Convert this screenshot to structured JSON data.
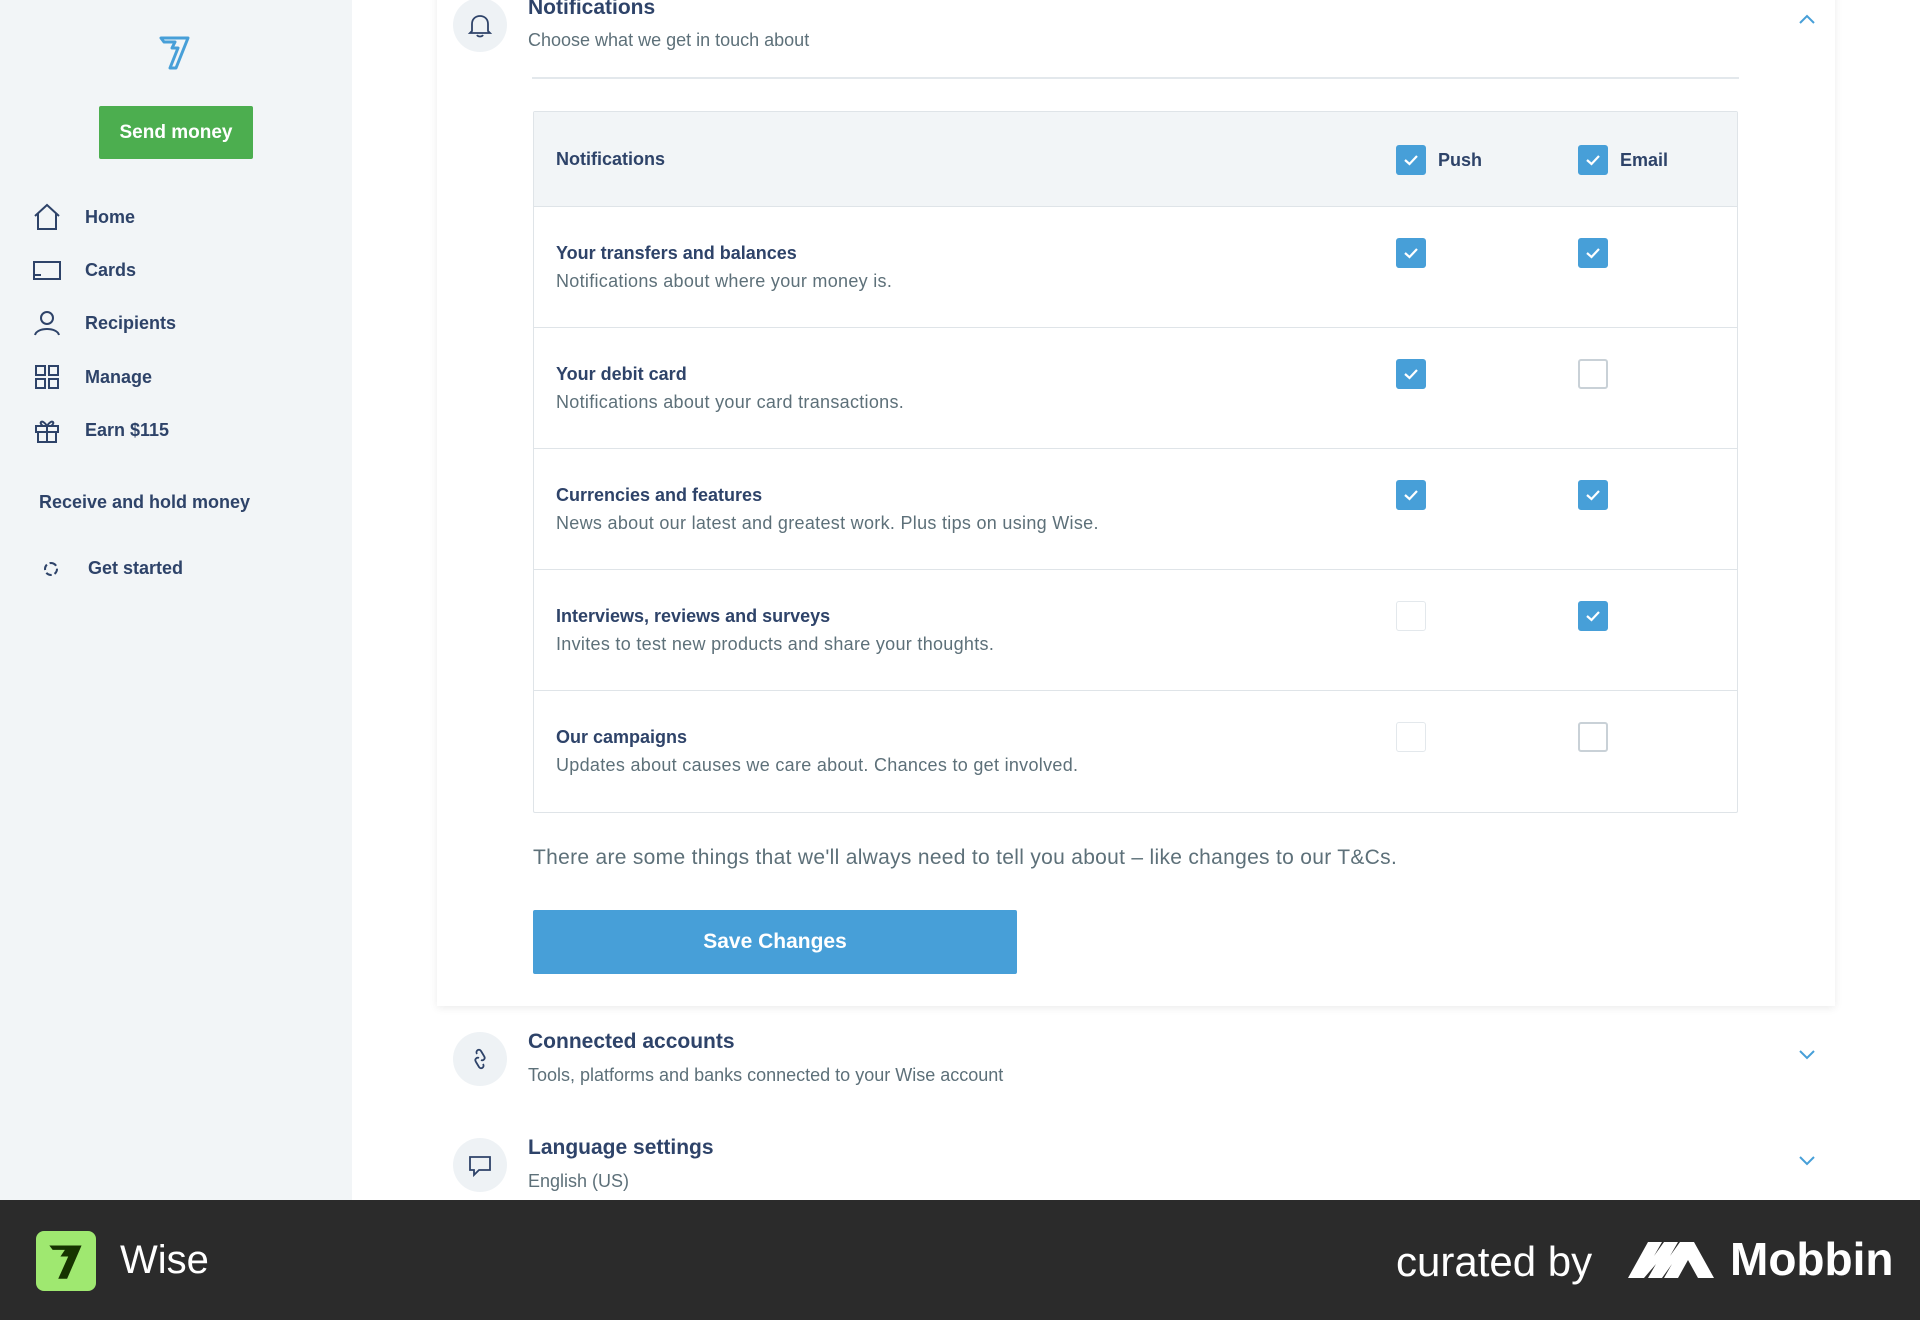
{
  "sidebar": {
    "send_money": "Send money",
    "nav": [
      {
        "label": "Home",
        "icon": "home-icon"
      },
      {
        "label": "Cards",
        "icon": "card-icon"
      },
      {
        "label": "Recipients",
        "icon": "recipients-icon"
      },
      {
        "label": "Manage",
        "icon": "grid-icon"
      },
      {
        "label": "Earn $115",
        "icon": "gift-icon"
      }
    ],
    "receive_title": "Receive and hold money",
    "get_started": "Get started"
  },
  "notifications": {
    "title": "Notifications",
    "subtitle": "Choose what we get in touch about",
    "expanded": true,
    "table_header": "Notifications",
    "col_push": "Push",
    "col_email": "Email",
    "header_push_checked": true,
    "header_email_checked": true,
    "rows": [
      {
        "title": "Your transfers and balances",
        "desc": "Notifications about where your money is.",
        "push": true,
        "email": true
      },
      {
        "title": "Your debit card",
        "desc": "Notifications about your card transactions.",
        "push": true,
        "email": false
      },
      {
        "title": "Currencies and features",
        "desc": "News about our latest and greatest work. Plus tips on using Wise.",
        "push": true,
        "email": true
      },
      {
        "title": "Interviews, reviews and surveys",
        "desc": "Invites to test new products and share your thoughts.",
        "push": false,
        "email": true
      },
      {
        "title": "Our campaigns",
        "desc": "Updates about causes we care about. Chances to get involved.",
        "push": false,
        "email": false
      }
    ],
    "note": "There are some things that we'll always need to tell you about – like changes to our T&Cs.",
    "save": "Save Changes"
  },
  "connected": {
    "title": "Connected accounts",
    "subtitle": "Tools, platforms and banks connected to your Wise account"
  },
  "language": {
    "title": "Language settings",
    "subtitle": "English (US)"
  },
  "footer": {
    "brand": "Wise",
    "curated": "curated by",
    "mobbin": "Mobbin"
  },
  "colors": {
    "accent": "#479fd8",
    "send_green": "#4cae4f",
    "text": "#2e4369",
    "wise_green": "#9fe870"
  }
}
